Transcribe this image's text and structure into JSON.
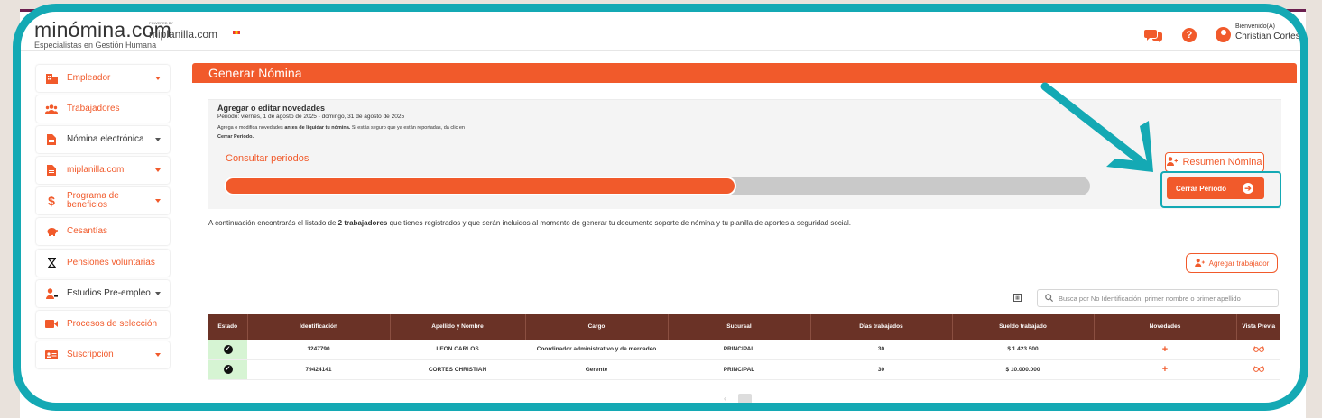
{
  "header": {
    "logo_main": "minómina.com",
    "logo_sub": "Especialistas en Gestión Humana",
    "powered_by": "POWERED BY",
    "partner": "miplanilla.com",
    "welcome": "Bienvenido(A)",
    "user_name": "Christian Cortes"
  },
  "sidebar": {
    "items": [
      {
        "label": "Empleador",
        "icon": "building-icon"
      },
      {
        "label": "Trabajadores",
        "icon": "users-icon"
      },
      {
        "label": "Nómina electrónica",
        "icon": "document-icon"
      },
      {
        "label": "miplanilla.com",
        "icon": "document-icon"
      },
      {
        "label": "Programa de beneficios",
        "icon": "dollar-icon"
      },
      {
        "label": "Cesantías",
        "icon": "piggy-bank-icon"
      },
      {
        "label": "Pensiones voluntarias",
        "icon": "hourglass-icon"
      },
      {
        "label": "Estudios Pre-empleo",
        "icon": "user-check-icon"
      },
      {
        "label": "Procesos de selección",
        "icon": "video-icon"
      },
      {
        "label": "Suscripción",
        "icon": "id-card-icon"
      }
    ]
  },
  "main": {
    "title": "Generar Nómina",
    "novedades_title": "Agregar o editar novedades",
    "period": "Periodo: viernes, 1 de agosto de 2025 - domingo, 31 de agosto de 2025",
    "help_text_1": "Agrega o modifica novedades ",
    "help_text_bold_1": "antes de liquidar tu nómina.",
    "help_text_2": " Si estás seguro que ya están reportadas, da clic en ",
    "help_text_bold_2": "Cerrar Periodo.",
    "consultar_label": "Consultar periodos",
    "progress_fraction": 0.59,
    "resumen_label": "Resumen Nómina",
    "cerrar_label": "Cerrar Periodo",
    "info_pre": "A continuación encontrarás el listado de ",
    "info_bold": "2 trabajadores",
    "info_post": " que tienes registrados y que serán incluidos al momento de generar tu documento soporte de nómina y tu planilla de aportes a seguridad social.",
    "agregar_label": "Agregar trabajador",
    "search_placeholder": "Busca por No Identificación, primer nombre o primer apellido"
  },
  "table": {
    "headers": [
      "Estado",
      "Identificación",
      "Apellido y Nombre",
      "Cargo",
      "Sucursal",
      "Días trabajados",
      "Sueldo trabajado",
      "Novedades",
      "Vista Previa"
    ],
    "rows": [
      {
        "id": "1247790",
        "name": "LEON CARLOS",
        "cargo": "Coordinador administrativo y de mercadeo",
        "sucursal": "PRINCIPAL",
        "dias": "30",
        "sueldo": "$ 1.423.500"
      },
      {
        "id": "79424141",
        "name": "CORTES CHRISTIAN",
        "cargo": "Gerente",
        "sucursal": "PRINCIPAL",
        "dias": "30",
        "sueldo": "$ 10.000.000"
      }
    ]
  },
  "colors": {
    "accent": "#f15a2b",
    "table_header": "#6a3226",
    "highlight": "#14a9b4",
    "status_ok": "#d6f4d3"
  }
}
